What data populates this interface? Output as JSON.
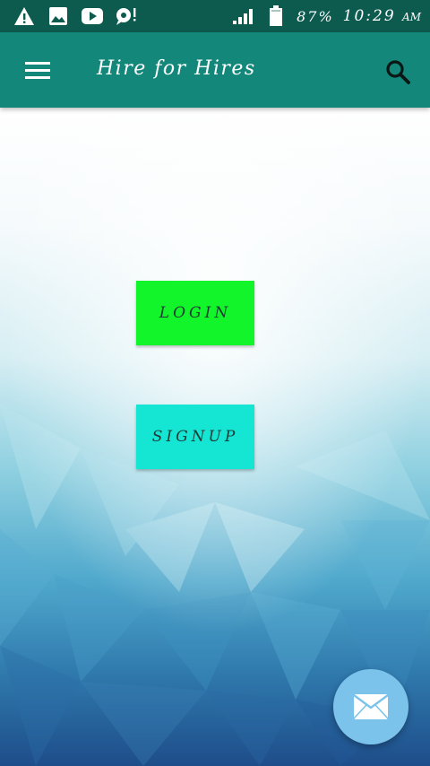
{
  "status_bar": {
    "icons": [
      "warning-icon",
      "image-icon",
      "youtube-icon",
      "chat-alert-icon",
      "signal-icon",
      "battery-icon"
    ],
    "battery": "87%",
    "time": "10:29",
    "ampm": "AM"
  },
  "toolbar": {
    "title": "Hire for Hires",
    "menu_icon": "hamburger-menu-icon",
    "search_icon": "search-icon"
  },
  "buttons": {
    "login": "LOGIN",
    "signup": "SIGNUP"
  },
  "fab": {
    "icon": "mail-icon"
  },
  "colors": {
    "status_bar": "#0d5a4f",
    "toolbar": "#12877a",
    "login_button": "#12f52a",
    "signup_button": "#15e6d4",
    "fab": "#7cc3ec"
  }
}
